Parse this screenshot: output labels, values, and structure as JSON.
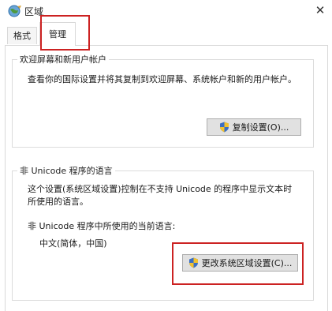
{
  "window": {
    "title": "区域",
    "close_glyph": "✕"
  },
  "tabs": [
    {
      "label": "格式"
    },
    {
      "label": "管理"
    }
  ],
  "welcome_group": {
    "title": "欢迎屏幕和新用户帐户",
    "description": "查看你的国际设置并将其复制到欢迎屏幕、系统帐户和新的用户帐户。",
    "copy_button": "复制设置(O)..."
  },
  "unicode_group": {
    "title": "非 Unicode 程序的语言",
    "description": "这个设置(系统区域设置)控制在不支持 Unicode 的程序中显示文本时所使用的语言。",
    "current_label": "非 Unicode 程序中所使用的当前语言:",
    "current_value": "中文(简体，中国)",
    "change_button": "更改系统区域设置(C)..."
  },
  "icons": {
    "title": "globe-icon",
    "button": "uac-shield-icon"
  },
  "colors": {
    "highlight": "#cc2222",
    "button_bg": "#e1e1e1"
  }
}
